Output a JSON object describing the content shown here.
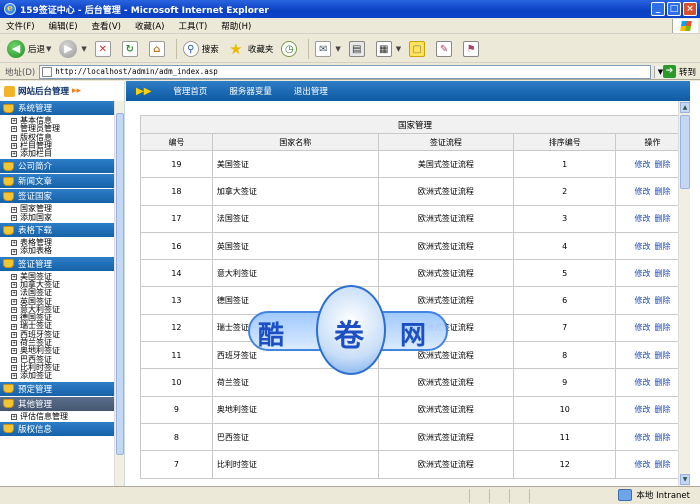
{
  "window": {
    "title": "159签证中心 - 后台管理 - Microsoft Internet Explorer"
  },
  "menu": [
    "文件(F)",
    "编辑(E)",
    "查看(V)",
    "收藏(A)",
    "工具(T)",
    "帮助(H)"
  ],
  "toolbar": {
    "back_label": "后退",
    "search_label": "搜索",
    "favorites_label": "收藏夹"
  },
  "address": {
    "label": "地址(D)",
    "url": "http://localhost/admin/adm_index.asp",
    "go_label": "转到"
  },
  "sidebar": {
    "title": "网站后台管理",
    "sections": [
      {
        "title": "系统管理",
        "items": [
          "基本信息",
          "管理员管理",
          "版权信息",
          "栏目管理",
          "添加栏目"
        ]
      },
      {
        "title": "公司简介",
        "items": []
      },
      {
        "title": "新闻文章",
        "items": []
      },
      {
        "title": "签证国家",
        "items": [
          "国家管理",
          "添加国家"
        ]
      },
      {
        "title": "表格下载",
        "items": [
          "表格管理",
          "添加表格"
        ]
      },
      {
        "title": "签证管理",
        "items": [
          "美国签证",
          "加拿大签证",
          "法国签证",
          "英国签证",
          "意大利签证",
          "德国签证",
          "瑞士签证",
          "西班牙签证",
          "荷兰签证",
          "奥地利签证",
          "巴西签证",
          "比利时签证",
          "添加签证"
        ]
      },
      {
        "title": "预定管理",
        "items": []
      },
      {
        "title": "其他管理",
        "items": [
          "评估信息管理"
        ]
      },
      {
        "title": "版权信息",
        "items": []
      }
    ]
  },
  "topnav": {
    "links": [
      "管理首页",
      "服务器变量",
      "退出管理"
    ]
  },
  "table": {
    "caption": "国家管理",
    "headers": [
      "编号",
      "国家名称",
      "签证流程",
      "排序编号",
      "操作"
    ],
    "edit_label": "修改",
    "delete_label": "删除",
    "rows": [
      {
        "id": "19",
        "name": "美国签证",
        "flow": "美国式签证流程",
        "order": "1"
      },
      {
        "id": "18",
        "name": "加拿大签证",
        "flow": "欧洲式签证流程",
        "order": "2"
      },
      {
        "id": "17",
        "name": "法国签证",
        "flow": "欧洲式签证流程",
        "order": "3"
      },
      {
        "id": "16",
        "name": "英国签证",
        "flow": "欧洲式签证流程",
        "order": "4"
      },
      {
        "id": "14",
        "name": "意大利签证",
        "flow": "欧洲式签证流程",
        "order": "5"
      },
      {
        "id": "13",
        "name": "德国签证",
        "flow": "欧洲式签证流程",
        "order": "6"
      },
      {
        "id": "12",
        "name": "瑞士签证",
        "flow": "欧洲式签证流程",
        "order": "7"
      },
      {
        "id": "11",
        "name": "西班牙签证",
        "flow": "欧洲式签证流程",
        "order": "8"
      },
      {
        "id": "10",
        "name": "荷兰签证",
        "flow": "欧洲式签证流程",
        "order": "9"
      },
      {
        "id": "9",
        "name": "奥地利签证",
        "flow": "欧洲式签证流程",
        "order": "10"
      },
      {
        "id": "8",
        "name": "巴西签证",
        "flow": "欧洲式签证流程",
        "order": "11"
      },
      {
        "id": "7",
        "name": "比利时签证",
        "flow": "欧洲式签证流程",
        "order": "12"
      }
    ]
  },
  "watermark": {
    "chars": [
      "酷",
      "卷",
      "网"
    ]
  },
  "status": {
    "zone": "本地 Intranet"
  },
  "colors": {
    "nav_blue": "#1662a8",
    "link_blue": "#1747b6",
    "accent_orange": "#f07c12"
  }
}
